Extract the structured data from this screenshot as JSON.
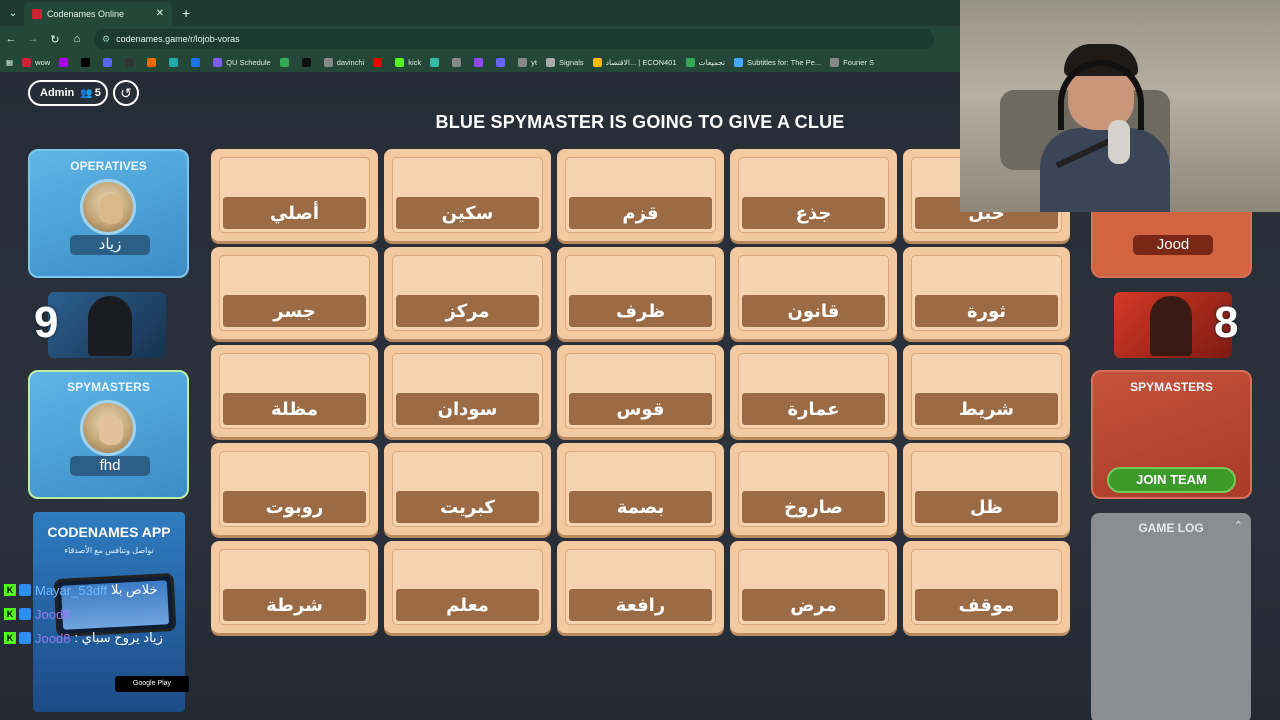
{
  "browser": {
    "tab_title": "Codenames Online",
    "url": "codenames.game/r/lojob-voras",
    "bookmarks": [
      {
        "label": "wow",
        "color": "#c23"
      },
      {
        "label": "",
        "color": "#a0f"
      },
      {
        "label": "",
        "color": "#000"
      },
      {
        "label": "",
        "color": "#5865f2"
      },
      {
        "label": "",
        "color": "#333"
      },
      {
        "label": "",
        "color": "#f60"
      },
      {
        "label": "",
        "color": "#2aa"
      },
      {
        "label": "",
        "color": "#1a73e8"
      },
      {
        "label": "QU Schedule",
        "color": "#7b5cf0"
      },
      {
        "label": "",
        "color": "#34a853"
      },
      {
        "label": "",
        "color": "#111"
      },
      {
        "label": "davinchi",
        "color": "#888"
      },
      {
        "label": "",
        "color": "#e00"
      },
      {
        "label": "kick",
        "color": "#53fc18"
      },
      {
        "label": "",
        "color": "#3ba"
      },
      {
        "label": "",
        "color": "#888"
      },
      {
        "label": "",
        "color": "#9146ff"
      },
      {
        "label": "",
        "color": "#66f"
      },
      {
        "label": "yt",
        "color": "#888"
      },
      {
        "label": "Signals",
        "color": "#aaa"
      },
      {
        "label": "الاقتصاد... | ECON401",
        "color": "#fbbc04"
      },
      {
        "label": "تجميعات",
        "color": "#34a853"
      },
      {
        "label": "Subtitles for: The Pe...",
        "color": "#4af"
      },
      {
        "label": "Fourier S",
        "color": "#888"
      }
    ]
  },
  "header": {
    "admin_label": "Admin",
    "player_count": "5",
    "banner": "BLUE SPYMASTER IS GOING TO GIVE A CLUE"
  },
  "blue_team": {
    "operatives_title": "OPERATIVES",
    "operative_name": "زياد",
    "score": "9",
    "spymasters_title": "SPYMASTERS",
    "spymaster_name": "fhd"
  },
  "red_team": {
    "operative_name": "Jood",
    "score": "8",
    "spymasters_title": "SPYMASTERS",
    "join_label": "JOIN TEAM"
  },
  "game_log": {
    "title": "GAME LOG"
  },
  "board": [
    [
      "أصلي",
      "سكين",
      "قزم",
      "جذع",
      "حبل"
    ],
    [
      "جسر",
      "مركز",
      "ظرف",
      "قانون",
      "ثورة"
    ],
    [
      "مظلة",
      "سودان",
      "قوس",
      "عمارة",
      "شريط"
    ],
    [
      "روبوت",
      "كبريت",
      "بصمة",
      "صاروخ",
      "ظل"
    ],
    [
      "شرطة",
      "معلم",
      "رافعة",
      "مرض",
      "موقف"
    ]
  ],
  "ad": {
    "title": "CODENAMES APP",
    "subtitle": "تواصل وتنافس مع الأصدقاء",
    "store": "Google Play"
  },
  "chat": [
    {
      "user": "Mayar_53dff",
      "user_color": "blue",
      "msg": "خلاص بلا"
    },
    {
      "user": "Jood8",
      "user_color": "purple",
      "msg": ""
    },
    {
      "user": "Jood8",
      "user_color": "purple",
      "msg": ": زياد يروح سباي"
    }
  ]
}
